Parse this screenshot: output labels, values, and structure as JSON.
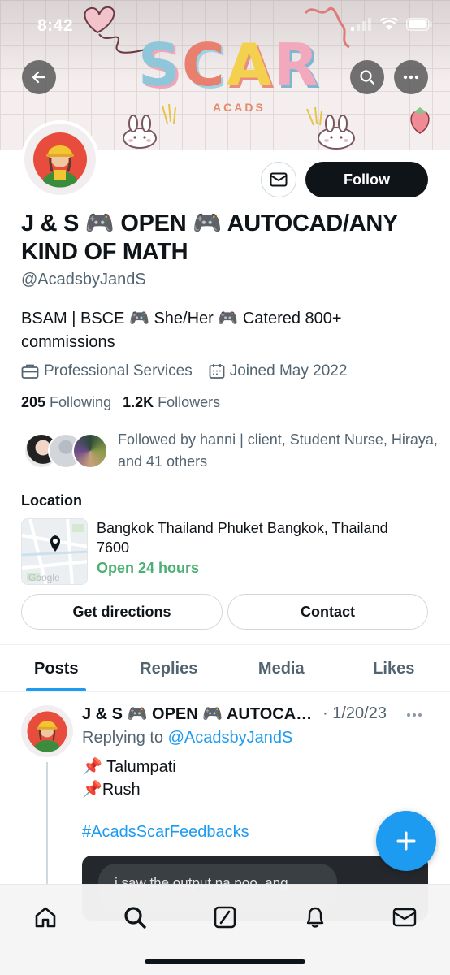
{
  "status_bar": {
    "time": "8:42"
  },
  "banner": {
    "title_letters": [
      "S",
      "C",
      "A",
      "R"
    ],
    "subtitle": "ACADS"
  },
  "profile": {
    "name": "J & S 🎮 OPEN 🎮 AUTOCAD/ANY KIND OF MATH",
    "handle": "@AcadsbyJandS",
    "bio": "BSAM | BSCE 🎮 She/Her 🎮 Catered 800+ commissions",
    "category": "Professional Services",
    "joined": "Joined May 2022",
    "following_count": "205",
    "following_label": "Following",
    "followers_count": "1.2K",
    "followers_label": "Followers",
    "followed_by": "Followed by hanni | client, Student Nurse, Hiraya, and 41 others"
  },
  "actions": {
    "follow_label": "Follow"
  },
  "location": {
    "title": "Location",
    "address": "Bangkok Thailand Phuket Bangkok, Thailand 7600",
    "hours": "Open 24 hours",
    "map_watermark": "Google",
    "directions_label": "Get directions",
    "contact_label": "Contact"
  },
  "tabs": [
    {
      "label": "Posts",
      "active": true
    },
    {
      "label": "Replies",
      "active": false
    },
    {
      "label": "Media",
      "active": false
    },
    {
      "label": "Likes",
      "active": false
    }
  ],
  "post": {
    "author": "J & S 🎮 OPEN 🎮 AUTOCAD/ANY KIND OF MATH",
    "date": "· 1/20/23",
    "replying_prefix": "Replying to ",
    "replying_handle": "@AcadsbyJandS",
    "lines": [
      "📌 Talumpati",
      "📌Rush"
    ],
    "hashtag": "#AcadsScarFeedbacks",
    "embed_text": "i saw the output na poo, ang"
  },
  "colors": {
    "accent": "#1d9bf0",
    "open_green": "#4caf73",
    "text_primary": "#0f1419",
    "text_secondary": "#536471"
  },
  "icons": {
    "header": [
      "back-arrow-icon",
      "search-icon",
      "more-icon"
    ],
    "meta": [
      "briefcase-icon",
      "calendar-icon"
    ],
    "nav": [
      "home-icon",
      "search-icon",
      "grok-icon",
      "bell-icon",
      "mail-icon"
    ]
  }
}
